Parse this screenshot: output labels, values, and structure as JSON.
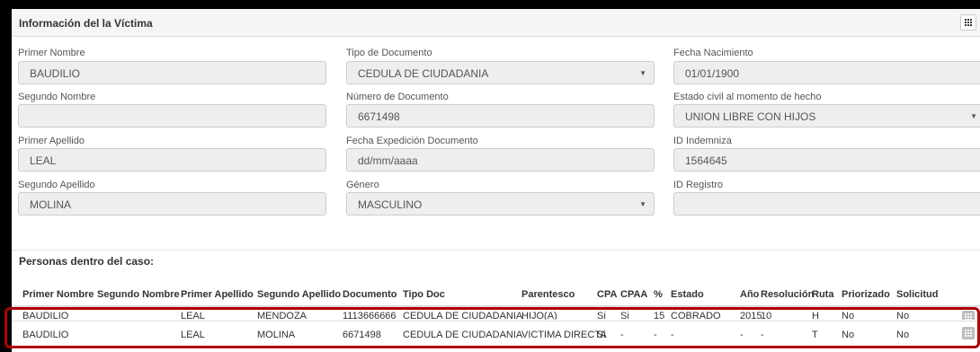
{
  "panel": {
    "title": "Información del la Víctima"
  },
  "fields": {
    "primer_nombre": {
      "label": "Primer Nombre",
      "value": "BAUDILIO"
    },
    "segundo_nombre": {
      "label": "Segundo Nombre",
      "value": ""
    },
    "primer_apellido": {
      "label": "Primer Apellido",
      "value": "LEAL"
    },
    "segundo_apellido": {
      "label": "Segundo Apellido",
      "value": "MOLINA"
    },
    "tipo_documento": {
      "label": "Tipo de Documento",
      "value": "CEDULA DE CIUDADANIA"
    },
    "numero_documento": {
      "label": "Número de Documento",
      "value": "6671498"
    },
    "fecha_expedicion": {
      "label": "Fecha Expedición Documento",
      "value": "dd/mm/aaaa"
    },
    "genero": {
      "label": "Género",
      "value": "MASCULINO"
    },
    "fecha_nacimiento": {
      "label": "Fecha Nacimiento",
      "value": "01/01/1900"
    },
    "estado_civil": {
      "label": "Estado civil al momento de hecho",
      "value": "UNION LIBRE CON HIJOS"
    },
    "id_indemniza": {
      "label": "ID Indemniza",
      "value": "1564645"
    },
    "id_registro": {
      "label": "ID Registro",
      "value": ""
    }
  },
  "persons": {
    "title": "Personas dentro del caso:",
    "columns": [
      "Primer Nombre",
      "Segundo Nombre",
      "Primer Apellido",
      "Segundo Apellido",
      "Documento",
      "Tipo Doc",
      "Parentesco",
      "CPA",
      "CPAA",
      "%",
      "Estado",
      "Año",
      "Resolución",
      "Ruta",
      "Priorizado",
      "Solicitud"
    ],
    "rows": [
      [
        "BAUDILIO",
        "",
        "LEAL",
        "MENDOZA",
        "1113666666",
        "CEDULA DE CIUDADANIA",
        "HIJO(A)",
        "Si",
        "Si",
        "15",
        "COBRADO",
        "2015",
        "10",
        "H",
        "No",
        "No"
      ],
      [
        "BAUDILIO",
        "",
        "LEAL",
        "MOLINA",
        "6671498",
        "CEDULA DE CIUDADANIA",
        "VICTIMA DIRECTA",
        "Si",
        "-",
        "-",
        "-",
        "-",
        "-",
        "T",
        "No",
        "No"
      ]
    ]
  }
}
